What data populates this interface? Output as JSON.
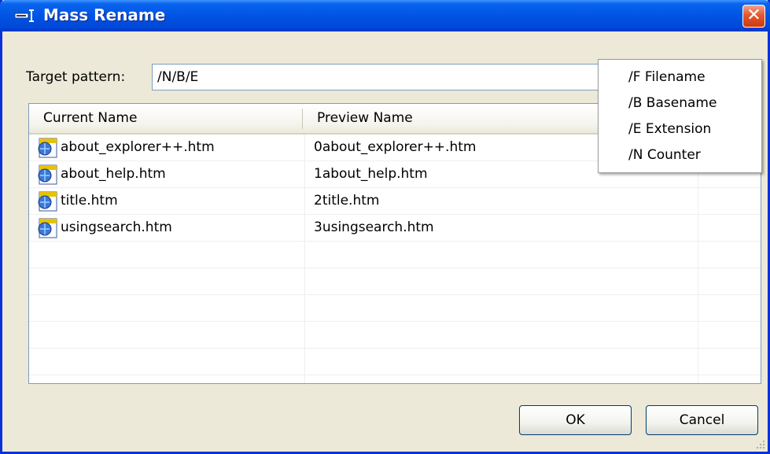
{
  "window": {
    "title": "Mass Rename"
  },
  "pattern": {
    "label": "Target pattern:",
    "value": "/N/B/E"
  },
  "columns": [
    "Current Name",
    "Preview Name"
  ],
  "rows": [
    {
      "current": "about_explorer++.htm",
      "preview": "0about_explorer++.htm"
    },
    {
      "current": "about_help.htm",
      "preview": "1about_help.htm"
    },
    {
      "current": "title.htm",
      "preview": "2title.htm"
    },
    {
      "current": "usingsearch.htm",
      "preview": "3usingsearch.htm"
    }
  ],
  "menu": [
    "/F Filename",
    "/B Basename",
    "/E Extension",
    "/N Counter"
  ],
  "buttons": {
    "ok": "OK",
    "cancel": "Cancel"
  },
  "colors": {
    "titlebar": "#0054e3",
    "face": "#ece9d8",
    "close": "#e4582f",
    "border": "#7f9db9"
  },
  "icons": {
    "title": "rename-icon",
    "file": "htm-file-icon",
    "close": "close-icon"
  }
}
